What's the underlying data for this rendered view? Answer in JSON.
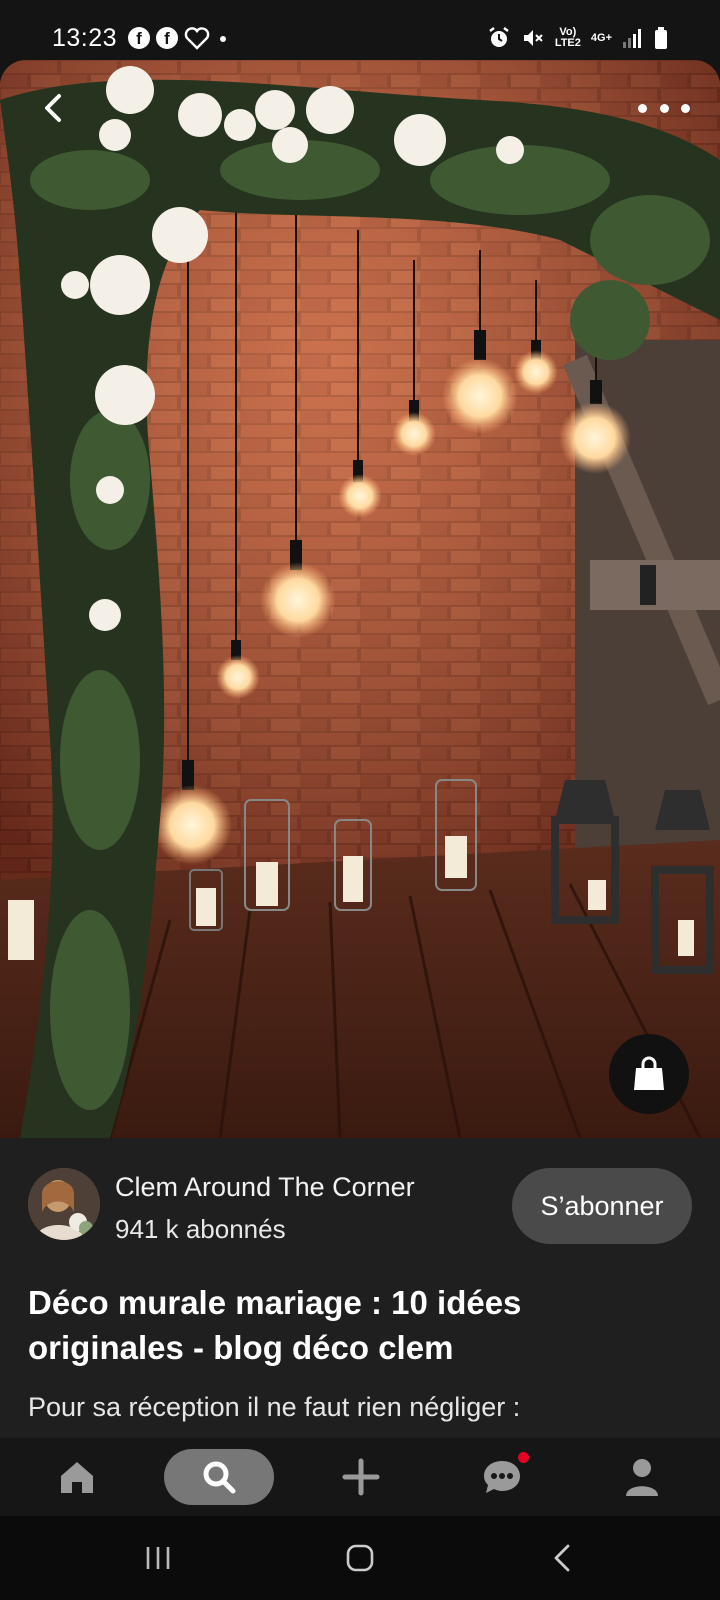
{
  "status_bar": {
    "time": "13:23",
    "left_icons": [
      "facebook-icon",
      "facebook-icon",
      "heart-icon",
      "dot-icon"
    ],
    "volte_line1": "Vo)",
    "volte_line2": "LTE2",
    "network": "4G+",
    "right_icons": [
      "alarm-icon",
      "mute-icon",
      "volte-icon",
      "signal-icon",
      "battery-icon"
    ]
  },
  "pin": {
    "image_alt": "",
    "creator": {
      "name": "Clem Around The Corner",
      "followers": "941 k abonnés"
    },
    "subscribe_label": "S’abonner",
    "title": "Déco murale mariage : 10 idées originales - blog déco clem",
    "description": "Pour sa réception il ne faut rien négliger :"
  },
  "tab_bar": {
    "items": [
      "home-icon",
      "search-icon",
      "plus-icon",
      "messages-icon",
      "profile-icon"
    ],
    "active": "search-icon",
    "notification_color": "#e60023"
  },
  "nav_bar": {
    "items": [
      "recent-apps-icon",
      "home-circle-icon",
      "back-icon"
    ]
  },
  "colors": {
    "background": "#1f1f1f",
    "subscribe_bg": "#4a4a4a",
    "active_tab_bg": "#777777"
  }
}
